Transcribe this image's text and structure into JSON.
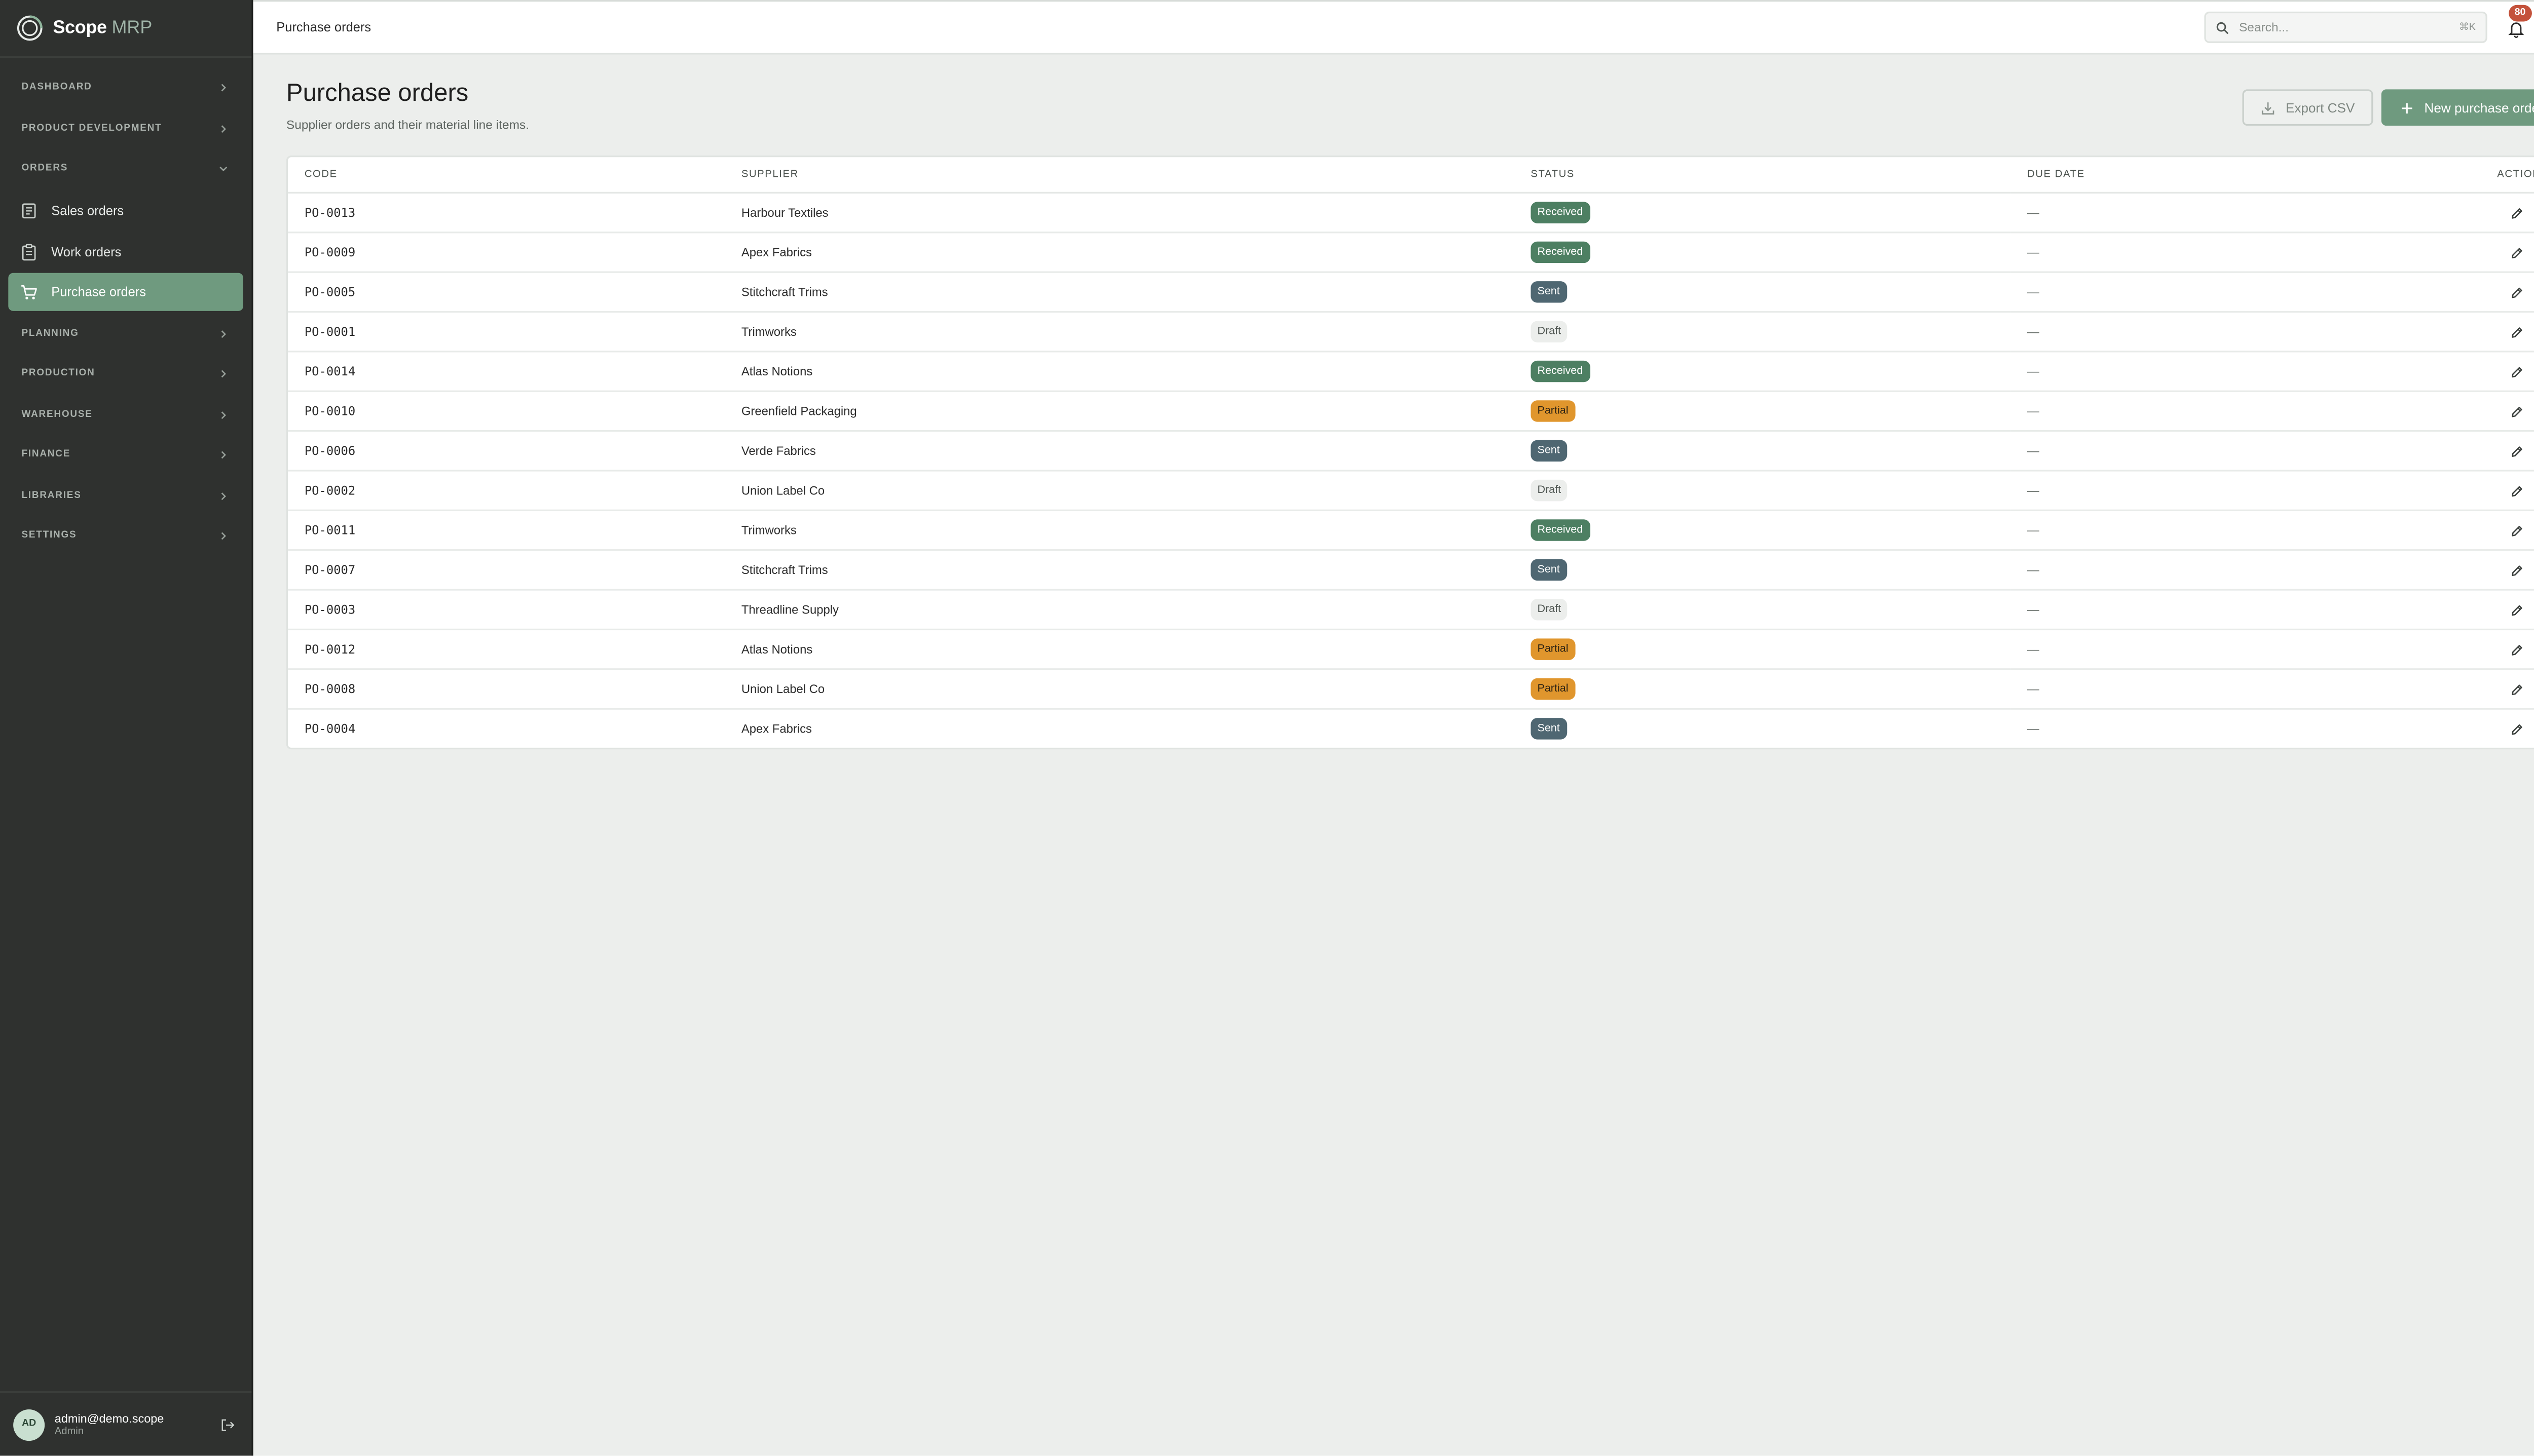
{
  "brand": {
    "name": "Scope",
    "suffix": "MRP"
  },
  "sidebar": {
    "sections": [
      {
        "label": "DASHBOARD",
        "expanded": false
      },
      {
        "label": "PRODUCT DEVELOPMENT",
        "expanded": false
      },
      {
        "label": "ORDERS",
        "expanded": true,
        "items": [
          {
            "label": "Sales orders",
            "icon": "receipt-icon",
            "active": false
          },
          {
            "label": "Work orders",
            "icon": "clipboard-icon",
            "active": false
          },
          {
            "label": "Purchase orders",
            "icon": "cart-icon",
            "active": true
          }
        ]
      },
      {
        "label": "PLANNING",
        "expanded": false
      },
      {
        "label": "PRODUCTION",
        "expanded": false
      },
      {
        "label": "WAREHOUSE",
        "expanded": false
      },
      {
        "label": "FINANCE",
        "expanded": false
      },
      {
        "label": "LIBRARIES",
        "expanded": false
      },
      {
        "label": "SETTINGS",
        "expanded": false
      }
    ],
    "user": {
      "initials": "AD",
      "email": "admin@demo.scope",
      "role": "Admin"
    }
  },
  "topbar": {
    "title": "Purchase orders",
    "search_placeholder": "Search...",
    "shortcut": "⌘K",
    "notifications": "80"
  },
  "page": {
    "title": "Purchase orders",
    "subtitle": "Supplier orders and their material line items.",
    "export_label": "Export CSV",
    "new_label": "New purchase order"
  },
  "table": {
    "headers": {
      "code": "CODE",
      "supplier": "SUPPLIER",
      "status": "STATUS",
      "due": "DUE DATE",
      "actions": "ACTIONS"
    },
    "rows": [
      {
        "code": "PO-0013",
        "supplier": "Harbour Textiles",
        "status": "Received",
        "due": "—"
      },
      {
        "code": "PO-0009",
        "supplier": "Apex Fabrics",
        "status": "Received",
        "due": "—"
      },
      {
        "code": "PO-0005",
        "supplier": "Stitchcraft Trims",
        "status": "Sent",
        "due": "—"
      },
      {
        "code": "PO-0001",
        "supplier": "Trimworks",
        "status": "Draft",
        "due": "—"
      },
      {
        "code": "PO-0014",
        "supplier": "Atlas Notions",
        "status": "Received",
        "due": "—"
      },
      {
        "code": "PO-0010",
        "supplier": "Greenfield Packaging",
        "status": "Partial",
        "due": "—"
      },
      {
        "code": "PO-0006",
        "supplier": "Verde Fabrics",
        "status": "Sent",
        "due": "—"
      },
      {
        "code": "PO-0002",
        "supplier": "Union Label Co",
        "status": "Draft",
        "due": "—"
      },
      {
        "code": "PO-0011",
        "supplier": "Trimworks",
        "status": "Received",
        "due": "—"
      },
      {
        "code": "PO-0007",
        "supplier": "Stitchcraft Trims",
        "status": "Sent",
        "due": "—"
      },
      {
        "code": "PO-0003",
        "supplier": "Threadline Supply",
        "status": "Draft",
        "due": "—"
      },
      {
        "code": "PO-0012",
        "supplier": "Atlas Notions",
        "status": "Partial",
        "due": "—"
      },
      {
        "code": "PO-0008",
        "supplier": "Union Label Co",
        "status": "Partial",
        "due": "—"
      },
      {
        "code": "PO-0004",
        "supplier": "Apex Fabrics",
        "status": "Sent",
        "due": "—"
      }
    ]
  },
  "colors": {
    "accent": "#6f9a7f",
    "sidebar": "#2f312f",
    "received": "#4d7f62",
    "sent": "#4f6772",
    "partial": "#e0962d",
    "delete": "#c4523b"
  }
}
